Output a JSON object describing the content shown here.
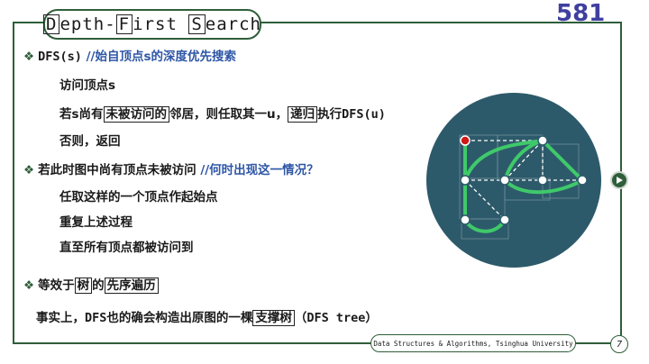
{
  "title": {
    "d": "D",
    "epth": "epth-",
    "f": "F",
    "irst": "irst ",
    "s": "S",
    "earch": "earch"
  },
  "page_number": "581",
  "lines": {
    "l1_code": "DFS(s)",
    "l1_comment": "//始自顶点s的深度优先搜索",
    "l2": "访问顶点s",
    "l3_a": "若s尚有",
    "l3_box1": "未被访问的",
    "l3_b": "邻居，则任取其一u，",
    "l3_box2": "递归",
    "l3_c": "执行",
    "l3_code": "DFS(u)",
    "l4": "否则，返回",
    "l5": "若此时图中尚有顶点未被访问",
    "l5_comment": "//何时出现这一情况？",
    "l6": "任取这样的一个顶点作起始点",
    "l7": "重复上述过程",
    "l8": "直至所有顶点都被访问到",
    "l9_a": "等效于",
    "l9_box1": "树",
    "l9_b": "的",
    "l9_box2": "先序遍历",
    "l10_a": "事实上，",
    "l10_code": "DFS",
    "l10_b": "也的确会构造出原图的一棵",
    "l10_box": "支撑树",
    "l10_c": "（",
    "l10_code2": "DFS tree",
    "l10_d": "）"
  },
  "footer": {
    "course": "Data Structures & Algorithms, Tsinghua University",
    "slide": "7"
  },
  "colors": {
    "frame": "#2f5e3a",
    "comment": "#2e56a6",
    "page_number": "#3f3fa0",
    "graph_bg": "#2d5a6a",
    "tree_edge": "#3fc96a",
    "start_vertex": "#d01818"
  },
  "icons": {
    "bullet": "diamond-bullet-icon",
    "next": "play-next-icon"
  }
}
